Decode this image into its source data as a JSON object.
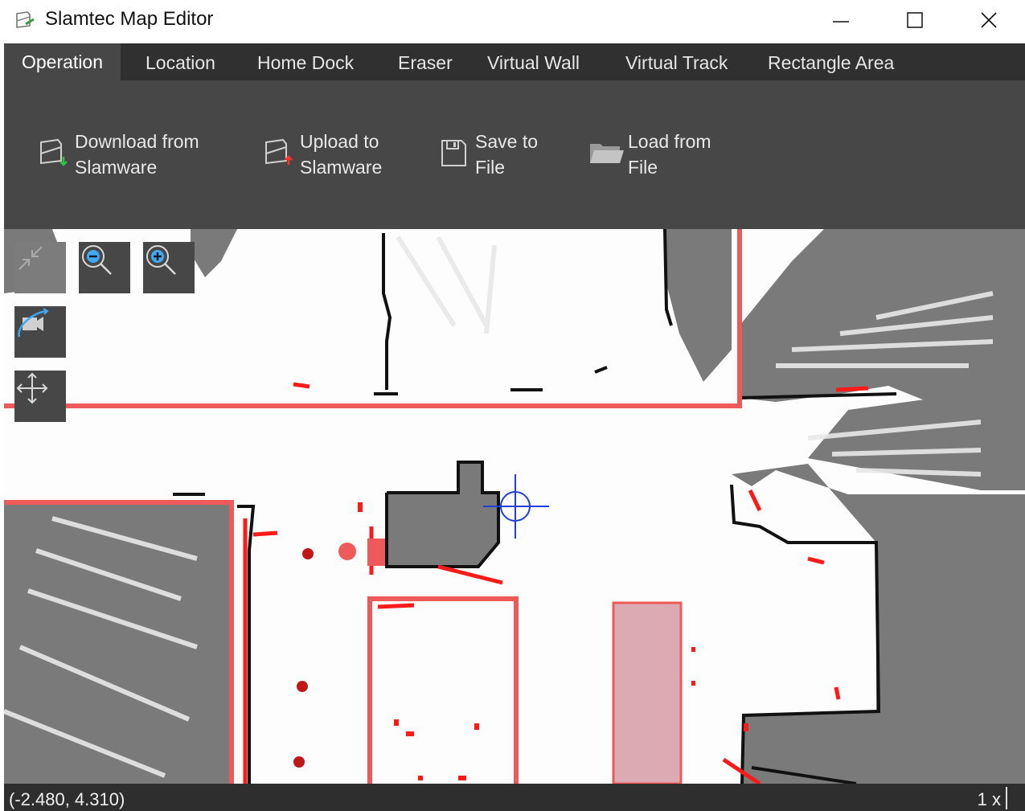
{
  "window": {
    "title": "Slamtec Map Editor",
    "minimize_icon": "minimize-icon",
    "maximize_icon": "maximize-icon",
    "close_icon": "close-icon"
  },
  "menu": {
    "tabs": [
      {
        "label": "Operation",
        "active": true
      },
      {
        "label": "Location",
        "active": false
      },
      {
        "label": "Home Dock",
        "active": false
      },
      {
        "label": "Eraser",
        "active": false
      },
      {
        "label": "Virtual Wall",
        "active": false
      },
      {
        "label": "Virtual Track",
        "active": false
      },
      {
        "label": "Rectangle Area",
        "active": false
      }
    ]
  },
  "ribbon": {
    "buttons": [
      {
        "line1": "Download from",
        "line2": "Slamware",
        "icon": "download-map-icon"
      },
      {
        "line1": "Upload to",
        "line2": "Slamware",
        "icon": "upload-map-icon"
      },
      {
        "line1": "Save to",
        "line2": "File",
        "icon": "save-icon"
      },
      {
        "line1": "Load from",
        "line2": "File",
        "icon": "folder-icon"
      }
    ]
  },
  "map_tools": {
    "fit": "shrink-arrows-icon",
    "zoom_out": "zoom-out-icon",
    "zoom_in": "zoom-in-icon",
    "camera": "rotate-camera-icon",
    "pan": "move-arrows-icon"
  },
  "status": {
    "coordinates": "(-2.480, 4.310)",
    "zoom": "1 x"
  },
  "colors": {
    "toolbar_bg": "#474747",
    "menubar_bg": "#303030",
    "rectangle_area": "#ee5a5a",
    "virtual_wall": "#ff1a1a",
    "obstacle": "#7a7a7a",
    "crosshair": "#1f3fd6"
  }
}
